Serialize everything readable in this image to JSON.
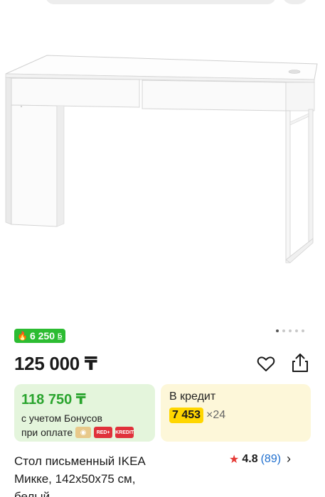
{
  "gallery": {
    "dots_total": 5,
    "active_index": 0
  },
  "bonus_badge": {
    "icon": "flame-icon",
    "amount": "6 250",
    "currency_sign": "Б"
  },
  "product": {
    "price": "125 000 ₸",
    "title_lines": [
      "Стол письменный IKEA",
      "Микке, 142x50x75 см,",
      "белый"
    ],
    "rating": {
      "score": "4.8",
      "count": "(89)"
    }
  },
  "actions": {
    "favorite_icon": "heart-icon",
    "share_icon": "share-icon"
  },
  "bonus_card": {
    "price": "118 750 ₸",
    "line1": "с учетом Бонусов",
    "line2": "при оплате",
    "payment_icons": [
      "Kaspi",
      "RED+",
      "KREDIT"
    ]
  },
  "credit_card": {
    "title": "В кредит",
    "monthly": "7 453",
    "months": "×24"
  },
  "colors": {
    "bonus_green": "#2cbc32",
    "bonus_bg": "#e4f5dc",
    "credit_bg": "#fdf7d9",
    "credit_highlight": "#ffd600",
    "rating_star": "#e53935",
    "link_blue": "#1f6fcf"
  }
}
